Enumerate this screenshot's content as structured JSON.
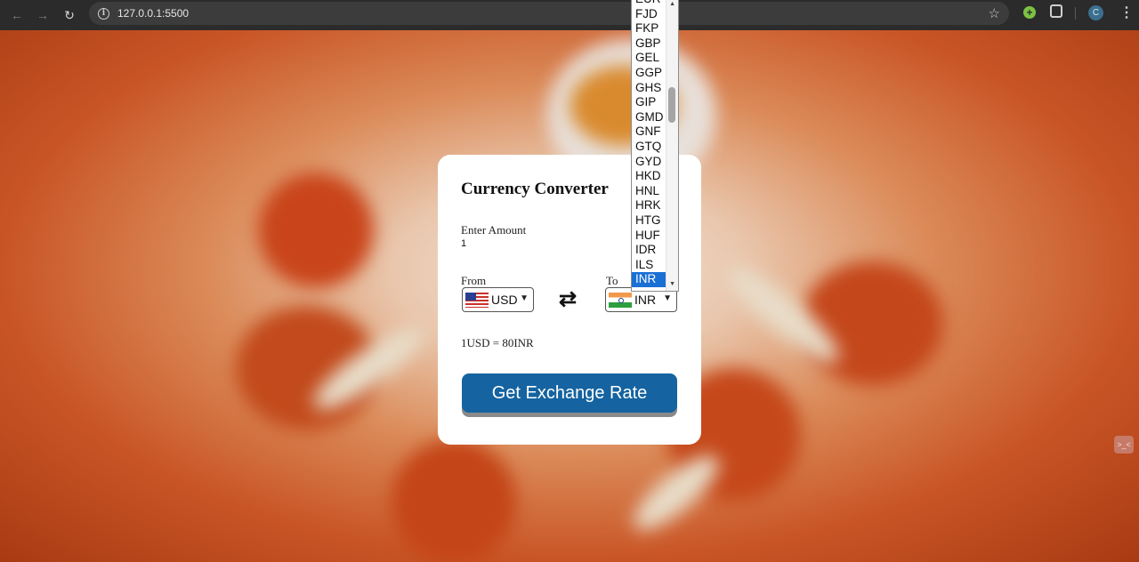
{
  "browser": {
    "url": "127.0.0.1:5500",
    "profile_initial": "C"
  },
  "converter": {
    "title": "Currency Converter",
    "amount_label": "Enter Amount",
    "amount_value": "1",
    "from_label": "From",
    "to_label": "To",
    "from_currency": "USD",
    "to_currency": "INR",
    "rate_message": "1USD = 80INR",
    "button_label": "Get Exchange Rate"
  },
  "dropdown": {
    "options": [
      "EUR",
      "FJD",
      "FKP",
      "GBP",
      "GEL",
      "GGP",
      "GHS",
      "GIP",
      "GMD",
      "GNF",
      "GTQ",
      "GYD",
      "HKD",
      "HNL",
      "HRK",
      "HTG",
      "HUF",
      "IDR",
      "ILS",
      "INR"
    ],
    "selected": "INR"
  },
  "icons": {
    "swap": "⇄",
    "back": "back-arrow-icon",
    "forward": "forward-arrow-icon",
    "reload": "reload-icon"
  },
  "colors": {
    "button": "#1563a0",
    "selected_option": "#1a6fd4",
    "background": "#c95a2a"
  }
}
